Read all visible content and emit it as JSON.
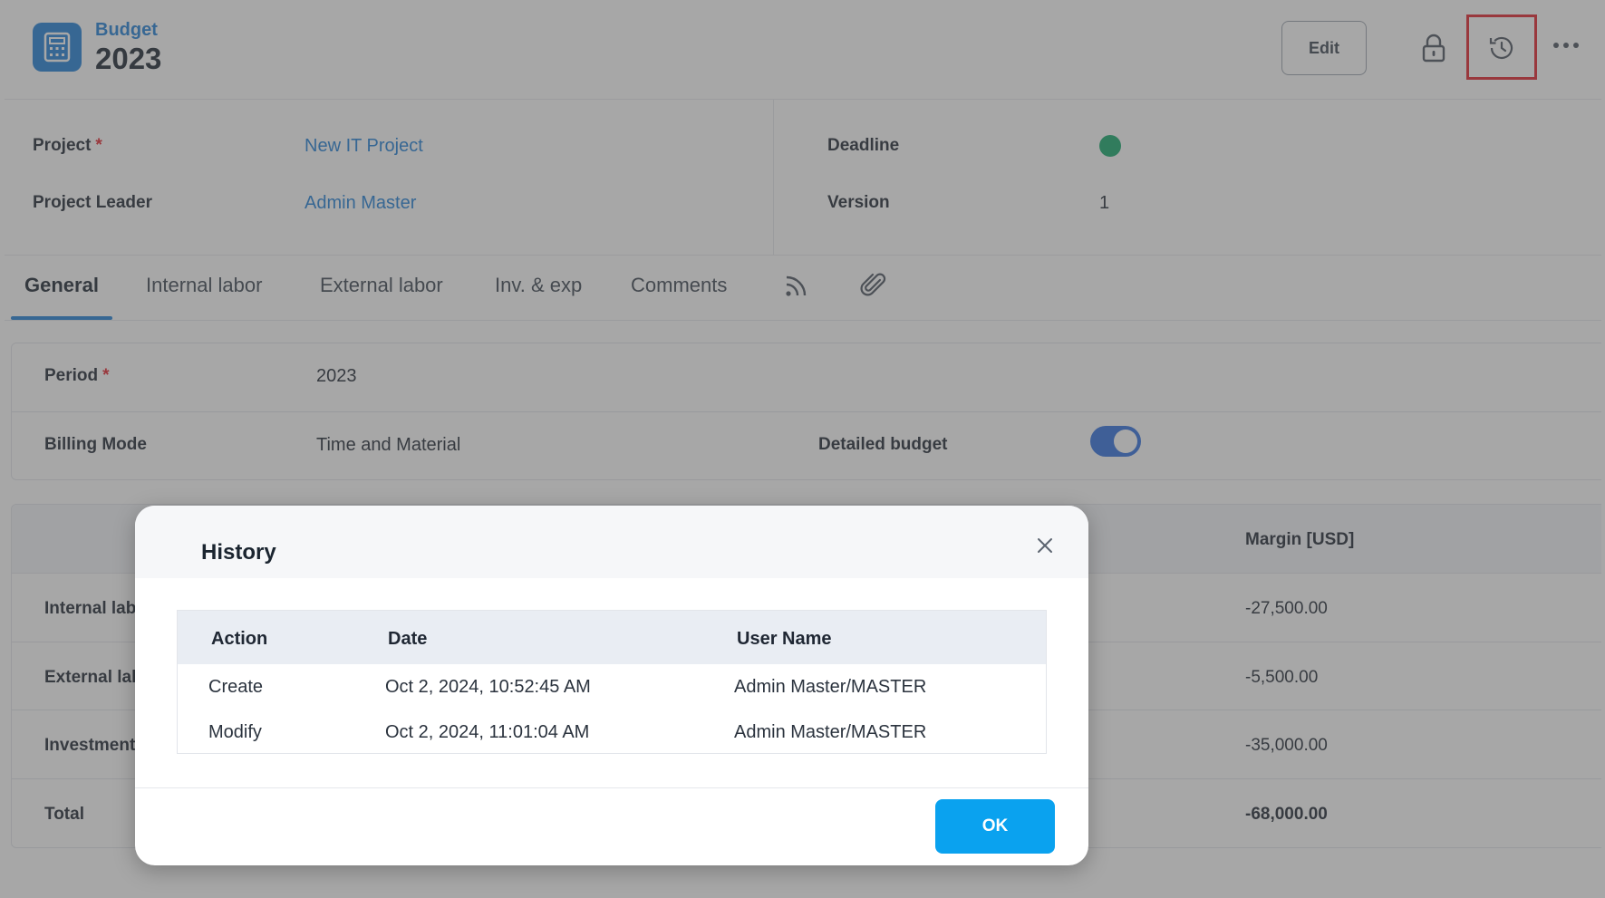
{
  "header": {
    "kicker": "Budget",
    "title": "2023",
    "edit_label": "Edit",
    "icons": [
      "calculator-icon",
      "lock-icon",
      "history-icon",
      "more-icon"
    ]
  },
  "project": {
    "project_label": "Project",
    "required_mark": "*",
    "project_value": "New IT Project",
    "leader_label": "Project Leader",
    "leader_value": "Admin Master",
    "deadline_label": "Deadline",
    "deadline_status_color": "#13a86b",
    "version_label": "Version",
    "version_value": "1"
  },
  "tabs": {
    "items": [
      "General",
      "Internal labor",
      "External labor",
      "Inv. & exp",
      "Comments"
    ],
    "active": "General",
    "icons": [
      "feed-icon",
      "paperclip-icon"
    ]
  },
  "general": {
    "period_label": "Period",
    "required_mark": "*",
    "period_value": "2023",
    "billing_label": "Billing Mode",
    "billing_value": "Time and Material",
    "detailed_label": "Detailed budget",
    "detailed_on": true
  },
  "summary": {
    "margin_header": "Margin [USD]",
    "rows": [
      {
        "label": "Internal lab",
        "margin": "-27,500.00"
      },
      {
        "label": "External lab",
        "margin": "-5,500.00"
      },
      {
        "label": "Investment",
        "margin": "-35,000.00"
      },
      {
        "label": "Total",
        "margin": "-68,000.00"
      }
    ]
  },
  "modal": {
    "title": "History",
    "columns": [
      "Action",
      "Date",
      "User Name"
    ],
    "rows": [
      {
        "action": "Create",
        "date": "Oct 2, 2024, 10:52:45 AM",
        "user": "Admin Master/MASTER"
      },
      {
        "action": "Modify",
        "date": "Oct 2, 2024, 11:01:04 AM",
        "user": "Admin Master/MASTER"
      }
    ],
    "ok_label": "OK"
  },
  "colors": {
    "brand": "#1f7ed6",
    "ok_button": "#0aa2ef",
    "highlight": "#e3202a"
  }
}
